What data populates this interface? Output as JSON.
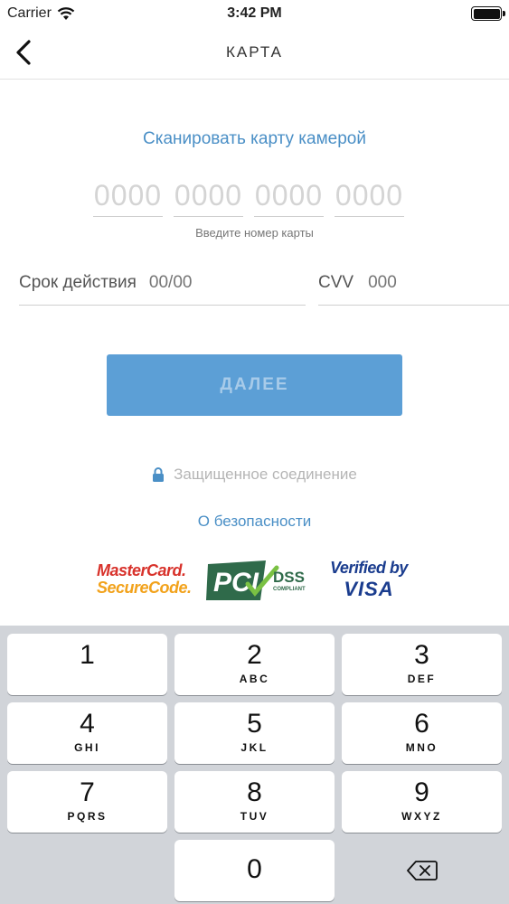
{
  "status_bar": {
    "carrier": "Carrier",
    "time": "3:42 PM"
  },
  "nav": {
    "title": "КАРТА"
  },
  "form": {
    "scan_link": "Сканировать карту камерой",
    "card_groups": [
      "0000",
      "0000",
      "0000",
      "0000"
    ],
    "card_hint": "Введите номер карты",
    "expiry_label": "Срок действия",
    "expiry_placeholder": "00/00",
    "cvv_label": "CVV",
    "cvv_placeholder": "000",
    "next_label": "ДАЛЕЕ",
    "secure_text": "Защищенное соединение",
    "security_link": "О безопасности"
  },
  "logos": {
    "mastercard_line1": "MasterCard.",
    "mastercard_line2": "SecureCode.",
    "pci_main": "PCI",
    "pci_dss": "DSS",
    "pci_compliant": "COMPLIANT",
    "visa_line1": "Verified by",
    "visa_line2": "VISA"
  },
  "keypad": {
    "keys": [
      {
        "digit": "1",
        "letters": ""
      },
      {
        "digit": "2",
        "letters": "ABC"
      },
      {
        "digit": "3",
        "letters": "DEF"
      },
      {
        "digit": "4",
        "letters": "GHI"
      },
      {
        "digit": "5",
        "letters": "JKL"
      },
      {
        "digit": "6",
        "letters": "MNO"
      },
      {
        "digit": "7",
        "letters": "PQRS"
      },
      {
        "digit": "8",
        "letters": "TUV"
      },
      {
        "digit": "9",
        "letters": "WXYZ"
      },
      {
        "digit": "0",
        "letters": ""
      }
    ]
  },
  "colors": {
    "accent": "#4a8fc6",
    "button": "#5c9fd6",
    "keypad_bg": "#d1d4d9"
  }
}
